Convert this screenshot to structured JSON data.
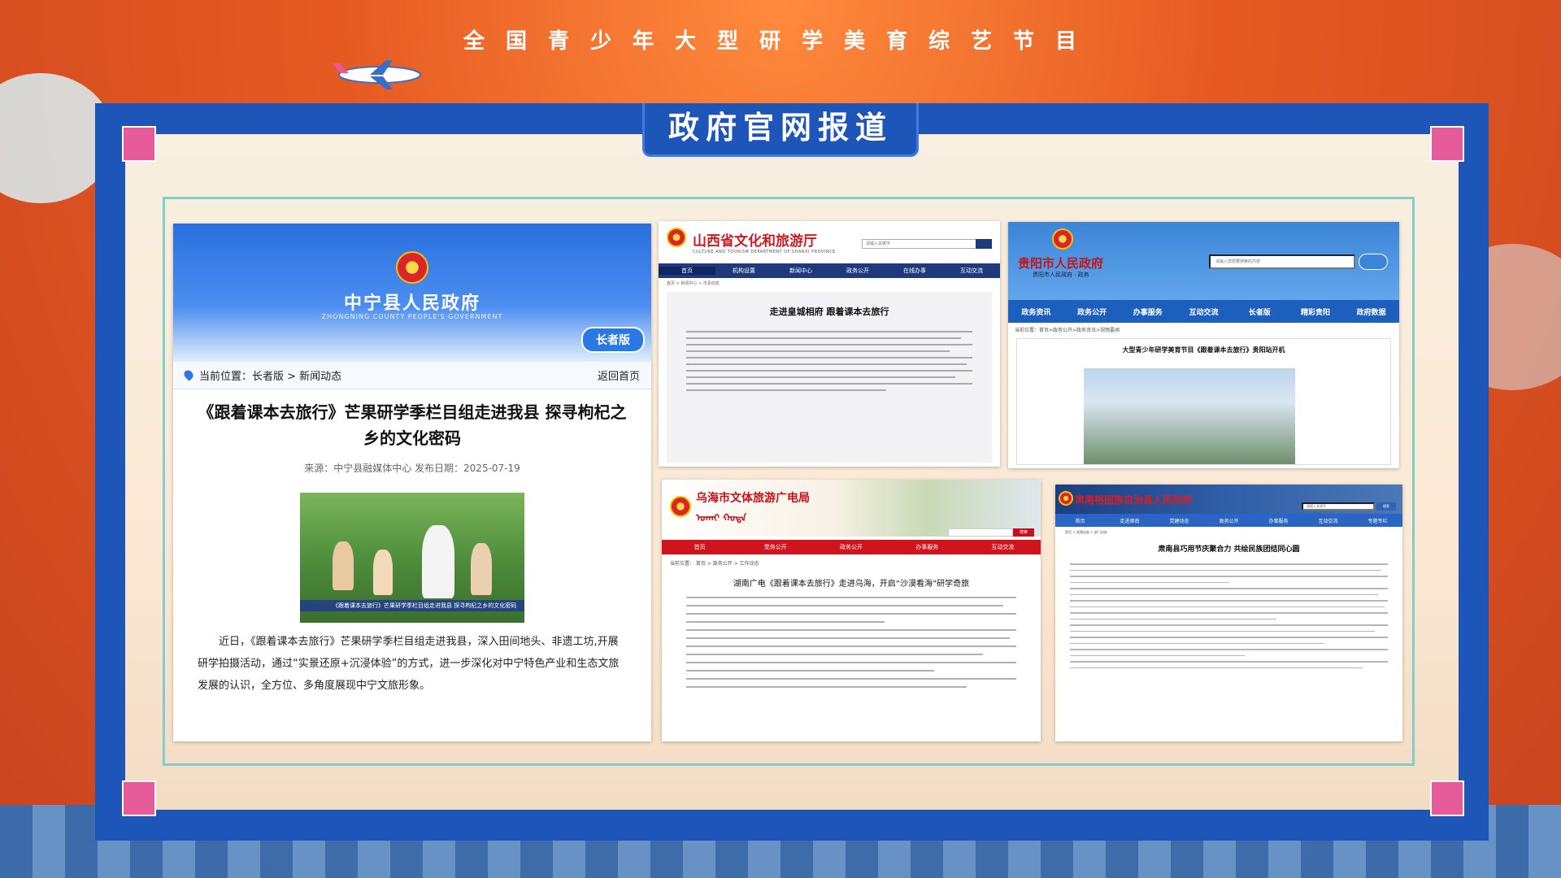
{
  "header": {
    "program_title": "全国青少年大型研学美育综艺节目",
    "section_banner": "政府官网报道"
  },
  "panels": {
    "zhongning": {
      "site_name": "中宁县人民政府",
      "site_sub": "ZHONGNING COUNTY PEOPLE'S GOVERNMENT",
      "elder_badge": "长者版",
      "breadcrumb": "当前位置：长者版 > 新闻动态",
      "back_link": "返回首页",
      "headline": "《跟着课本去旅行》芒果研学季栏目组走进我县 探寻枸杞之乡的文化密码",
      "meta": "来源：中宁县融媒体中心    发布日期：2025-07-19",
      "photo_caption": "《跟着课本去旅行》芒果研学季栏目组走进我县 探寻枸杞之乡的文化密码",
      "body": "近日，《跟着课本去旅行》芒果研学季栏目组走进我县，深入田间地头、非遗工坊,开展研学拍摄活动，通过“实景还原+沉浸体验”的方式，进一步深化对中宁特色产业和生态文旅发展的认识，全方位、多角度展现中宁文旅形象。"
    },
    "shanxi": {
      "site_name": "山西省文化和旅游厅",
      "site_en": "CULTURE AND TOURISM DEPARTMENT OF SHANXI PROVINCE",
      "search_placeholder": "请输入关键字",
      "nav": [
        "首页",
        "机构设置",
        "新闻中心",
        "政务公开",
        "在线办事",
        "互动交流"
      ],
      "breadcrumb": "首页 > 新闻中心 > 市县动态",
      "headline": "走进皇城相府 跟着课本去旅行"
    },
    "guiyang": {
      "site_name": "贵阳市人民政府",
      "site_sub": "贵阳市人民政府 · 政务",
      "search_placeholder": "请输入您想要搜索的内容",
      "nav": [
        "政务资讯",
        "政务公开",
        "办事服务",
        "互动交流",
        "长者版",
        "精彩贵阳",
        "政府数据"
      ],
      "breadcrumb": "当前位置：首页>政务公开>政务资讯>视频要闻",
      "headline": "大型青少年研学美育节目《跟着课本去旅行》贵阳站开机"
    },
    "wuhai": {
      "site_name": "乌海市文体旅游广电局",
      "search_btn": "搜索",
      "nav": [
        "首页",
        "党务公开",
        "政务公开",
        "办事服务",
        "互动交流"
      ],
      "breadcrumb": "当前位置：  首页 > 政务公开 > 工作动态",
      "headline": "湖南广电《跟着课本去旅行》走进乌海，开启“沙漠看海”研学奇旅"
    },
    "sunan": {
      "site_name": "肃南裕固族自治县人民政府",
      "search_placeholder": "请输入关键字",
      "search_btn": "搜索",
      "nav": [
        "首页",
        "走进肃南",
        "党建动态",
        "政务公开",
        "办事服务",
        "互动交流",
        "专题专栏"
      ],
      "breadcrumb": "首页 > 党建动态 > 部门动态",
      "headline": "肃南县巧用节庆聚合力 共绘民族团结同心圆"
    }
  },
  "colors": {
    "frame_blue": "#1e55b8",
    "accent_pink": "#e85b9a",
    "gov_red": "#c8101a"
  }
}
